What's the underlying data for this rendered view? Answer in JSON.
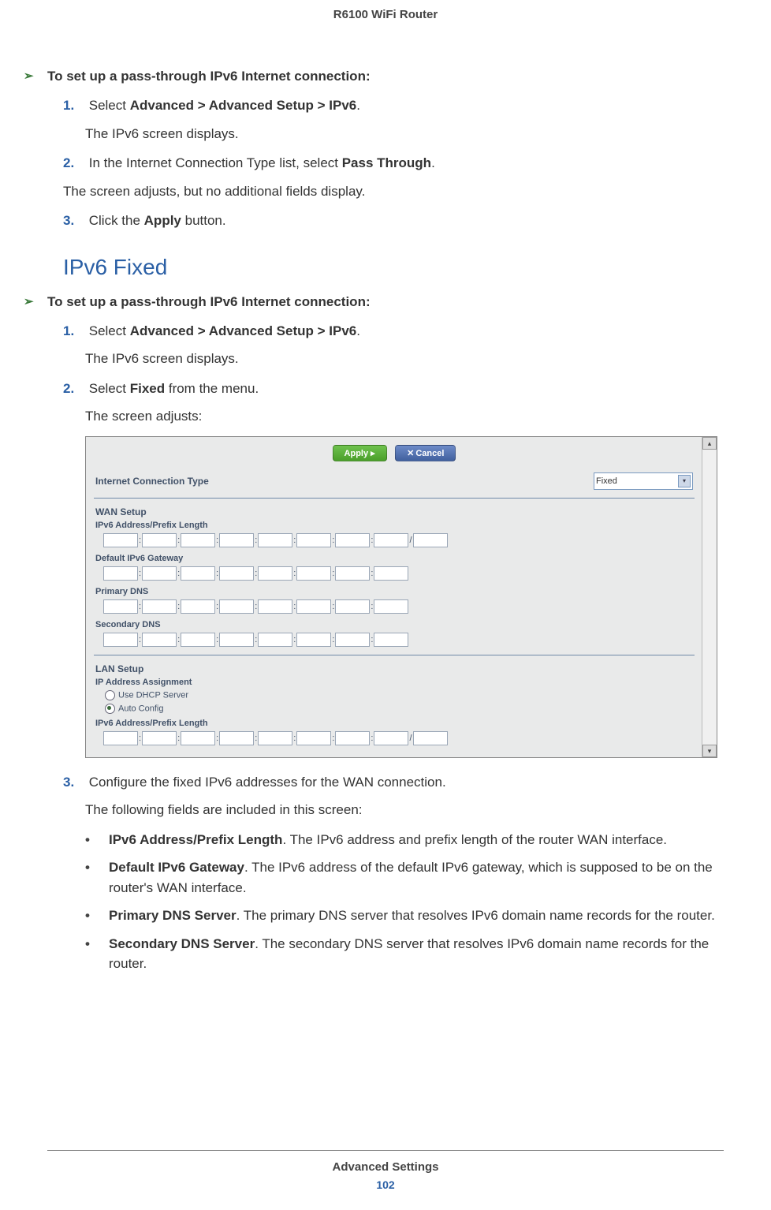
{
  "header": {
    "product": "R6100 WiFi Router"
  },
  "section1": {
    "heading": "To set up a pass-through IPv6 Internet connection:",
    "steps": [
      {
        "num": "1.",
        "text_a": "Select ",
        "text_b": "Advanced > Advanced Setup > IPv6",
        "text_c": ".",
        "body": "The IPv6 screen displays."
      },
      {
        "num": "2.",
        "text_a": "In the Internet Connection Type list, select ",
        "text_b": "Pass Through",
        "text_c": "."
      }
    ],
    "between": "The screen adjusts, but no additional fields display.",
    "step3": {
      "num": "3.",
      "text_a": "Click the ",
      "text_b": "Apply",
      "text_c": " button."
    }
  },
  "h2": "IPv6 Fixed",
  "section2": {
    "heading": "To set up a pass-through IPv6 Internet connection:",
    "steps": [
      {
        "num": "1.",
        "text_a": "Select ",
        "text_b": "Advanced > Advanced Setup > IPv6",
        "text_c": ".",
        "body": "The IPv6 screen displays."
      },
      {
        "num": "2.",
        "text_a": "Select ",
        "text_b": "Fixed",
        "text_c": " from the menu.",
        "body": "The screen adjusts:"
      }
    ],
    "step3": {
      "num": "3.",
      "text_a": "Configure the fixed IPv6 addresses for the WAN connection.",
      "body": "The following fields are included in this screen:"
    },
    "bullets": [
      {
        "bold": "IPv6 Address/Prefix Length",
        "rest": ". The IPv6 address and prefix length of the router WAN interface."
      },
      {
        "bold": "Default IPv6 Gateway",
        "rest": ". The IPv6 address of the default IPv6 gateway, which is supposed to be on the router's WAN interface."
      },
      {
        "bold": "Primary DNS Server",
        "rest": ". The primary DNS server that resolves IPv6 domain name records for the router."
      },
      {
        "bold": "Secondary DNS Server",
        "rest": ". The secondary DNS server that resolves IPv6 domain name records for the router."
      }
    ]
  },
  "screenshot": {
    "apply": "Apply ▸",
    "cancel_x": "✕",
    "cancel": "Cancel",
    "conn_label": "Internet Connection Type",
    "conn_value": "Fixed",
    "wan_setup": "WAN Setup",
    "addr_prefix": "IPv6 Address/Prefix Length",
    "default_gw": "Default IPv6 Gateway",
    "primary_dns": "Primary DNS",
    "secondary_dns": "Secondary DNS",
    "lan_setup": "LAN Setup",
    "ip_assign": "IP Address Assignment",
    "dhcp": "Use DHCP Server",
    "autoconf": "Auto Config",
    "addr_prefix2": "IPv6 Address/Prefix Length"
  },
  "footer": {
    "section": "Advanced Settings",
    "page": "102"
  }
}
